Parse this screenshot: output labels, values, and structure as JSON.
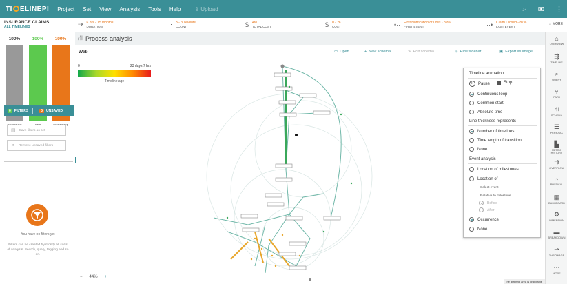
{
  "app": {
    "logo_left": "TI",
    "logo_right": "ELINEPI",
    "menu": [
      "Project",
      "Set",
      "View",
      "Analysis",
      "Tools",
      "Help"
    ],
    "upload_label": "Upload"
  },
  "dataset": {
    "name": "INSURANCE CLAIMS",
    "subtitle": "ALL TIMELINES"
  },
  "stats": [
    {
      "value": "6 hrs - 15 months",
      "label": "DURATION"
    },
    {
      "value": "3 - 30 events",
      "label": "COUNT"
    },
    {
      "value": "4M",
      "label": "TOTAL COST"
    },
    {
      "value": "0 - 2K",
      "label": "COST"
    },
    {
      "value": "First Notification of Loss - 89%",
      "label": "FIRST EVENT"
    },
    {
      "value": "Claim Closed - 87%",
      "label": "LAST EVENT"
    }
  ],
  "more_label": "MORE",
  "bars": {
    "project": {
      "pct": "100%",
      "label": "PROJECT",
      "count": "31,596",
      "fill": 1.0,
      "color": "#999999"
    },
    "set": {
      "pct": "100%",
      "label": "SET",
      "count": "31,596",
      "fill": 1.0,
      "color": "#5cc94e"
    },
    "current": {
      "pct": "100%",
      "label": "CURRENT",
      "count": "31,596",
      "fill": 1.0,
      "color": "#e8761a"
    }
  },
  "filters": {
    "count": "0",
    "label": "FILTERS",
    "unsaved_count": "0",
    "unsaved_label": "UNSAVED"
  },
  "save_filters_label": "Save filters as set",
  "remove_filters_label": "Remove unsaved filters",
  "no_filters_title": "You have no filters yet",
  "no_filters_desc": "Filters can be created by mostly all sorts of analysis. Search, query, tagging and so on.",
  "view": {
    "title": "Process analysis",
    "tab": "Web"
  },
  "toolbar": {
    "open": "Open",
    "new_schema": "New schema",
    "edit_schema": "Edit schema",
    "hide_sidebar": "Hide sidebar",
    "export": "Export as image"
  },
  "legend": {
    "min": "0",
    "max": "23 days 7 hrs",
    "caption": "Timeline age"
  },
  "animation": {
    "title": "Timeline animation",
    "pause": "Pause",
    "stop": "Stop",
    "loop_options": [
      "Continuous loop",
      "Common start",
      "Absolute time"
    ],
    "loop_selected": 0,
    "thickness_title": "Line thickness represents",
    "thickness_options": [
      "Number of timelines",
      "Time length of transition",
      "None"
    ],
    "thickness_selected": 0,
    "event_title": "Event analysis",
    "event_options": [
      "Location of milestones",
      "Location of",
      "Occurrence",
      "None"
    ],
    "event_selected": 2,
    "select_event": "Select event",
    "relative_to": "Relative to milestone",
    "before": "Before",
    "after": "After"
  },
  "right_tools": [
    "OVERVIEW",
    "TIMELINE",
    "QUERY",
    "PATH",
    "SCHEMA",
    "PERIODIC",
    "METRIC HISTORY",
    "OVERFLOW",
    "PHYSICAL",
    "DASHBOARD",
    "DIMENSION",
    "BREAKDOWN",
    "THROWAGE",
    "MORE"
  ],
  "zoom": "44%",
  "drawing_warning": "The drawing area is draggable"
}
